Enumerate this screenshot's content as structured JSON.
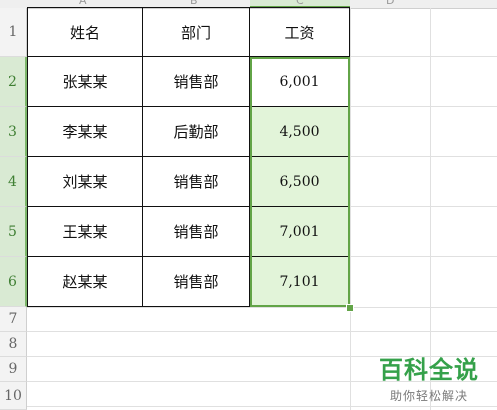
{
  "columns": [
    "A",
    "B",
    "C",
    "D"
  ],
  "rows": [
    "1",
    "2",
    "3",
    "4",
    "5",
    "6",
    "7",
    "8",
    "9",
    "10"
  ],
  "table": {
    "headers": [
      "姓名",
      "部门",
      "工资"
    ],
    "records": [
      {
        "name": "张某某",
        "dept": "销售部",
        "salary": "6,001"
      },
      {
        "name": "李某某",
        "dept": "后勤部",
        "salary": "4,500"
      },
      {
        "name": "刘某某",
        "dept": "销售部",
        "salary": "6,500"
      },
      {
        "name": "王某某",
        "dept": "销售部",
        "salary": "7,001"
      },
      {
        "name": "赵某某",
        "dept": "销售部",
        "salary": "7,101"
      }
    ]
  },
  "selection": {
    "range_column": "C",
    "rows": [
      "2",
      "3",
      "4",
      "5",
      "6"
    ]
  },
  "colors": {
    "selection": "#62a447",
    "selection_fill": "#e2f4d9",
    "watermark": "#35a14a"
  },
  "watermark": {
    "logo_text": "百科全说",
    "tagline": "助你轻松解决"
  }
}
